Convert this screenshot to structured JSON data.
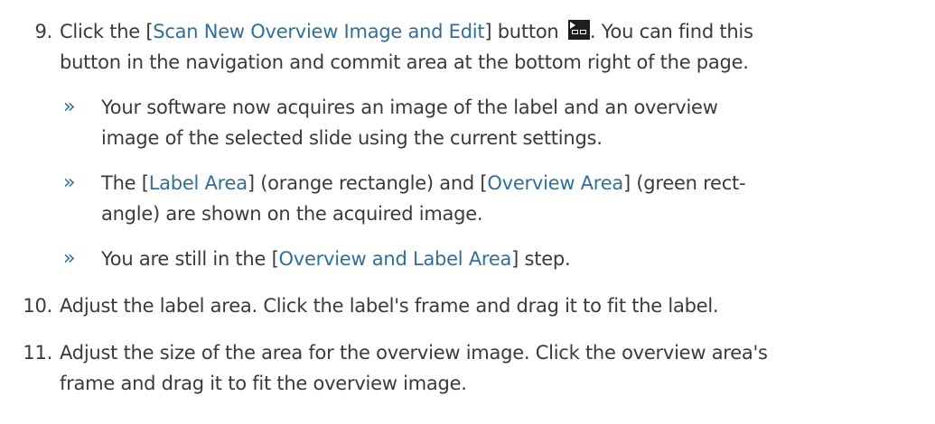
{
  "step9": {
    "number": "9.",
    "line1_a": "Click the [",
    "line1_ref": "Scan New Overview Image and Edit",
    "line1_b": "] button",
    "line1_c": ". You can find this",
    "line2": "button in the navigation and commit area at the bottom right of the page.",
    "icon": "scan-overview-edit-icon"
  },
  "results": [
    {
      "marker": "»",
      "line1": "Your software now acquires an image of the label and an overview",
      "line2": "image of the selected slide using the current settings."
    },
    {
      "marker": "»",
      "line1_a": "The [",
      "ref1": "Label Area",
      "line1_b": "] (orange rectangle) and [",
      "ref2": "Overview Area",
      "line1_c": "] (green rect-",
      "line2": "angle) are shown on the acquired image."
    },
    {
      "marker": "»",
      "line1_a": "You are still in the [",
      "ref1": "Overview and Label Area",
      "line1_b": "] step."
    }
  ],
  "step10": {
    "number": "10.",
    "text": "Adjust the label area. Click the label's frame and drag it to fit the label."
  },
  "step11": {
    "number": "11.",
    "line1": "Adjust the size of the area for the overview image. Click the overview area's",
    "line2": "frame and drag it to fit the overview image."
  },
  "colors": {
    "text": "#3a3a3a",
    "link": "#2f6f9a",
    "icon_bg": "#1e1e1e"
  }
}
